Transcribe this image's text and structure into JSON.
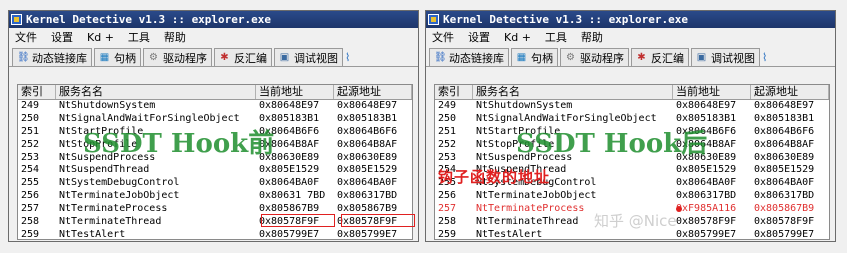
{
  "windows": [
    {
      "title": "Kernel Detective v1.3 :: explorer.exe",
      "menu": [
        "文件",
        "设置",
        "Kd +",
        "工具",
        "帮助"
      ],
      "tabs": [
        {
          "label": "动态链接库",
          "icon": "link-icon"
        },
        {
          "label": "句柄",
          "icon": "handle-icon"
        },
        {
          "label": "驱动程序",
          "icon": "gear-icon"
        },
        {
          "label": "反汇编",
          "icon": "bug-icon"
        },
        {
          "label": "调试视图",
          "icon": "debug-view-icon"
        }
      ],
      "columns": [
        "索引",
        "服务名名",
        "当前地址",
        "起源地址"
      ],
      "rows": [
        {
          "index": "249",
          "name": "NtShutdownSystem",
          "current": "0x80648E97",
          "origin": "0x80648E97"
        },
        {
          "index": "250",
          "name": "NtSignalAndWaitForSingleObject",
          "current": "0x805183B1",
          "origin": "0x805183B1"
        },
        {
          "index": "251",
          "name": "NtStartProfile",
          "current": "0x8064B6F6",
          "origin": "0x8064B6F6"
        },
        {
          "index": "252",
          "name": "NtStopProfile",
          "current": "0x8064B8AF",
          "origin": "0x8064B8AF"
        },
        {
          "index": "253",
          "name": "NtSuspendProcess",
          "current": "0x80630E89",
          "origin": "0x80630E89"
        },
        {
          "index": "254",
          "name": "NtSuspendThread",
          "current": "0x805E1529",
          "origin": "0x805E1529"
        },
        {
          "index": "255",
          "name": "NtSystemDebugControl",
          "current": "0x8064BA0F",
          "origin": "0x8064BA0F"
        },
        {
          "index": "256",
          "name": "NtTerminateJobObject",
          "current": "0x80631 7BD",
          "origin": "0x806317BD"
        },
        {
          "index": "257",
          "name": "NtTerminateProcess",
          "current": "0x805867B9",
          "origin": "0x805867B9"
        },
        {
          "index": "258",
          "name": "NtTerminateThread",
          "current": "0x80578F9F",
          "origin": "0x80578F9F"
        },
        {
          "index": "259",
          "name": "NtTestAlert",
          "current": "0x805799E7",
          "origin": "0x805799E7"
        }
      ],
      "overlay": "SSDT Hook前"
    },
    {
      "title": "Kernel Detective v1.3 :: explorer.exe",
      "menu": [
        "文件",
        "设置",
        "Kd +",
        "工具",
        "帮助"
      ],
      "tabs": [
        {
          "label": "动态链接库",
          "icon": "link-icon"
        },
        {
          "label": "句柄",
          "icon": "handle-icon"
        },
        {
          "label": "驱动程序",
          "icon": "gear-icon"
        },
        {
          "label": "反汇编",
          "icon": "bug-icon"
        },
        {
          "label": "调试视图",
          "icon": "debug-view-icon"
        }
      ],
      "columns": [
        "索引",
        "服务名名",
        "当前地址",
        "起源地址"
      ],
      "rows": [
        {
          "index": "249",
          "name": "NtShutdownSystem",
          "current": "0x80648E97",
          "origin": "0x80648E97"
        },
        {
          "index": "250",
          "name": "NtSignalAndWaitForSingleObject",
          "current": "0x805183B1",
          "origin": "0x805183B1"
        },
        {
          "index": "251",
          "name": "NtStartProfile",
          "current": "0x8064B6F6",
          "origin": "0x8064B6F6"
        },
        {
          "index": "252",
          "name": "NtStopProfile",
          "current": "0x8064B8AF",
          "origin": "0x8064B8AF"
        },
        {
          "index": "253",
          "name": "NtSuspendProcess",
          "current": "0x80630E89",
          "origin": "0x80630E89"
        },
        {
          "index": "254",
          "name": "NtSuspendThread",
          "current": "0x805E1529",
          "origin": "0x805E1529"
        },
        {
          "index": "255",
          "name": "NtSystemDebugControl",
          "current": "0x8064BA0F",
          "origin": "0x8064BA0F"
        },
        {
          "index": "256",
          "name": "NtTerminateJobObject",
          "current": "0x806317BD",
          "origin": "0x806317BD"
        },
        {
          "index": "257",
          "name": "NtTerminateProcess",
          "current": "0xF985A116",
          "origin": "0x805867B9"
        },
        {
          "index": "258",
          "name": "NtTerminateThread",
          "current": "0x80578F9F",
          "origin": "0x80578F9F"
        },
        {
          "index": "259",
          "name": "NtTestAlert",
          "current": "0x805799E7",
          "origin": "0x805799E7"
        }
      ],
      "overlay": "SSDT Hook后",
      "annotation": "钩子函数的地址",
      "watermark": "知乎 @Nice"
    }
  ],
  "colors": {
    "hooked_row": "#e03030",
    "highlight_box": "#e02020",
    "overlay_text": "#1f8f2f",
    "titlebar": "#1d356a"
  }
}
